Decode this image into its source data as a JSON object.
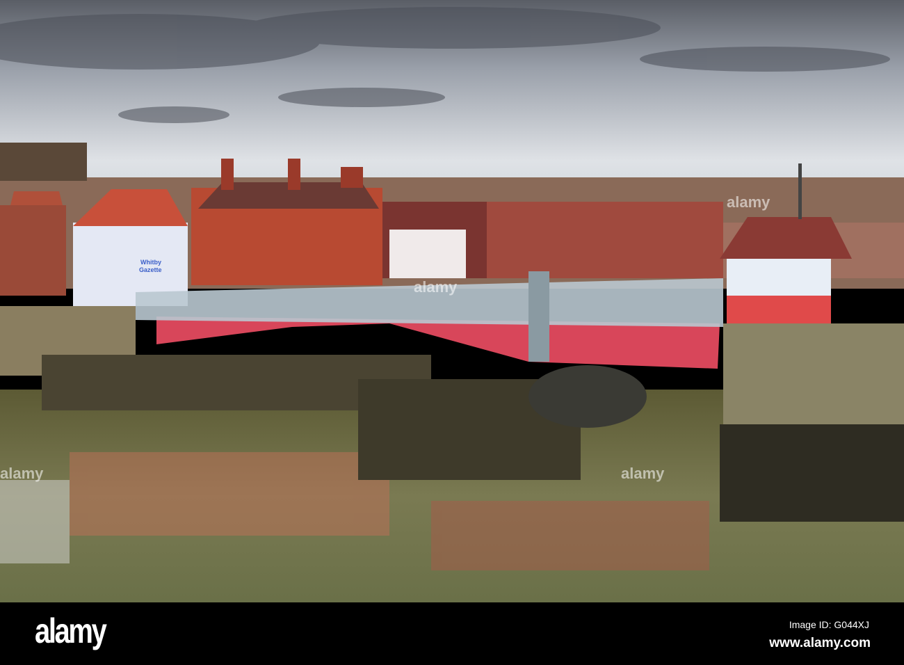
{
  "photo": {
    "shop_sign_line1": "Whitby",
    "shop_sign_line2": "Gazette"
  },
  "watermark": {
    "logo": "alamy",
    "image_id": "Image ID: G044XJ",
    "url": "www.alamy.com",
    "overlay_text": "alamy"
  },
  "colors": {
    "bridge_red": "#d8465a",
    "railing": "#b9c8d0",
    "water": "#6a6a3a",
    "sky": "#c8ccd2"
  }
}
